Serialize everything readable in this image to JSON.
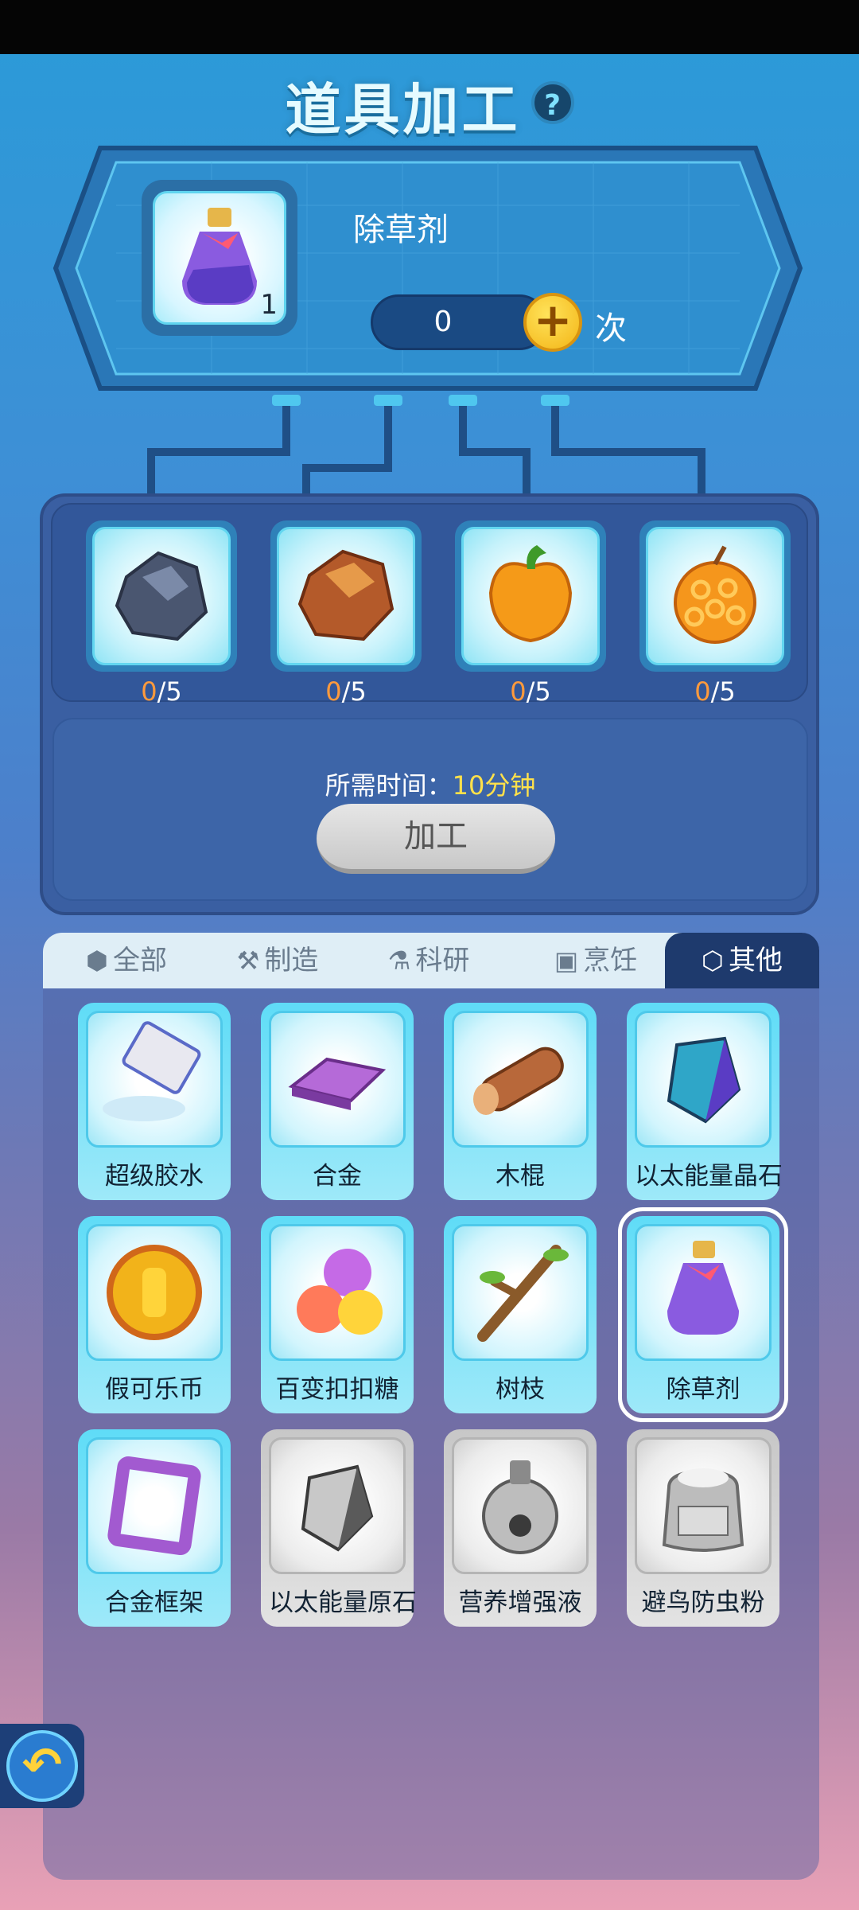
{
  "header": {
    "title": "道具加工",
    "help": "?"
  },
  "product": {
    "name": "除草剂",
    "count": "1",
    "quantity": "0",
    "plus": "+",
    "unit": "次"
  },
  "materials": [
    {
      "name": "stone",
      "have": "0",
      "need": "/5"
    },
    {
      "name": "copper-ore",
      "have": "0",
      "need": "/5"
    },
    {
      "name": "pepper",
      "have": "0",
      "need": "/5"
    },
    {
      "name": "fruit",
      "have": "0",
      "need": "/5"
    }
  ],
  "craft": {
    "time_label": "所需时间：",
    "time_value": "10分钟",
    "button": "加工"
  },
  "tabs": [
    {
      "label": "全部",
      "icon": "shield-icon"
    },
    {
      "label": "制造",
      "icon": "tools-icon"
    },
    {
      "label": "科研",
      "icon": "flask-icon"
    },
    {
      "label": "烹饪",
      "icon": "stove-icon"
    },
    {
      "label": "其他",
      "icon": "cube-icon"
    }
  ],
  "items": [
    {
      "label": "超级胶水"
    },
    {
      "label": "合金"
    },
    {
      "label": "木棍"
    },
    {
      "label": "以太能量晶石"
    },
    {
      "label": "假可乐币"
    },
    {
      "label": "百变扣扣糖"
    },
    {
      "label": "树枝"
    },
    {
      "label": "除草剂"
    },
    {
      "label": "合金框架"
    },
    {
      "label": "以太能量原石"
    },
    {
      "label": "营养增强液"
    },
    {
      "label": "避鸟防虫粉",
      "pic_text": "避鸟\n防虫粉"
    }
  ],
  "colors": {
    "accent": "#ffe14a",
    "have": "#ff9a3c",
    "active_tab": "#1e3a6d"
  }
}
